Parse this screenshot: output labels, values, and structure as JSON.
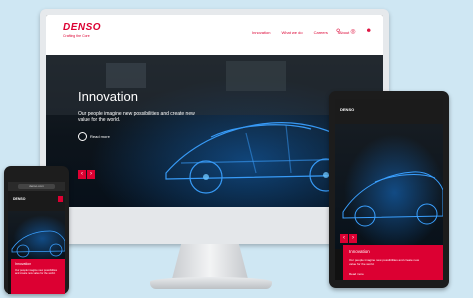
{
  "desktop": {
    "brand": "DENSO",
    "tagline": "Crafting the Core",
    "nav": [
      "Innovation",
      "What we do",
      "Careers",
      "About"
    ],
    "hero_title": "Innovation",
    "hero_subtitle": "Our people imagine new possibilities and create new value for the world.",
    "hero_cta": "Read more"
  },
  "tablet": {
    "brand": "DENSO",
    "card_title": "Innovation",
    "card_subtitle": "Our people imagine new possibilities and create new value for the world.",
    "card_cta": "Read more"
  },
  "phone": {
    "url": "denso.com",
    "brand": "DENSO",
    "card_title": "Innovation",
    "card_subtitle": "Our people imagine new possibilities and create new value for the world."
  },
  "colors": {
    "brand_red": "#dc0032",
    "background": "#cfe7f3"
  }
}
